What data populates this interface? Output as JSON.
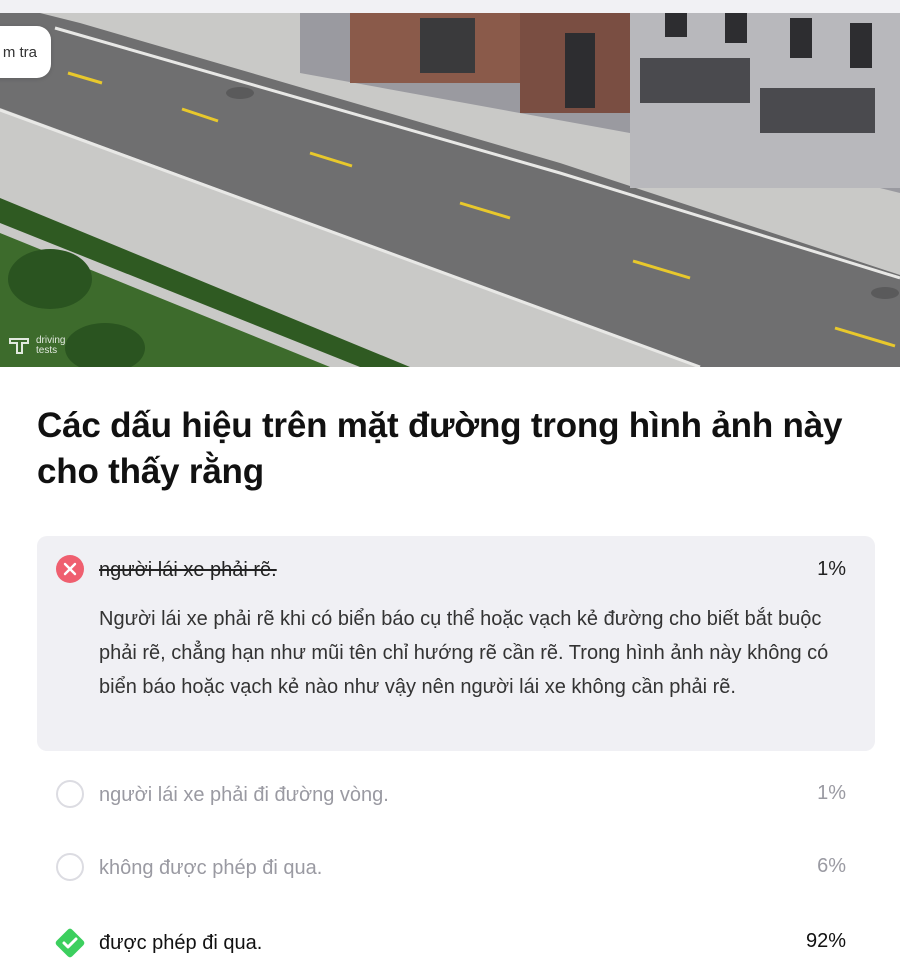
{
  "hero": {
    "tag_label": "m tra",
    "watermark_text": "driving tests",
    "colors": {
      "road": "#6f6f70",
      "lane_marking": "#e8c82c",
      "sidewalk": "#c9c9c7",
      "grass": "#3d6b2c",
      "hedge": "#2f5a22",
      "building_brick": "#8a5a4a",
      "building_light": "#b8b8bc"
    }
  },
  "question": {
    "text": "Các dấu hiệu trên mặt đường trong hình ảnh này cho thấy rằng"
  },
  "answers": [
    {
      "label": "người lái xe phải rẽ.",
      "percent": "1%",
      "state": "wrong",
      "explanation": "Người lái xe phải rẽ khi có biển báo cụ thể hoặc vạch kẻ đường cho biết bắt buộc phải rẽ, chẳng hạn như mũi tên chỉ hướng rẽ cần rẽ. Trong hình ảnh này không có biển báo hoặc vạch kẻ nào như vậy nên người lái xe không cần phải rẽ."
    },
    {
      "label": "người lái xe phải đi đường vòng.",
      "percent": "1%",
      "state": "unselected"
    },
    {
      "label": "không được phép đi qua.",
      "percent": "6%",
      "state": "unselected"
    },
    {
      "label": "được phép đi qua.",
      "percent": "92%",
      "state": "correct"
    }
  ],
  "colors": {
    "wrong": "#ef5f6f",
    "correct": "#3ccf5e",
    "selected_bg": "#f0f0f4",
    "muted_text": "#9a9aa2"
  }
}
